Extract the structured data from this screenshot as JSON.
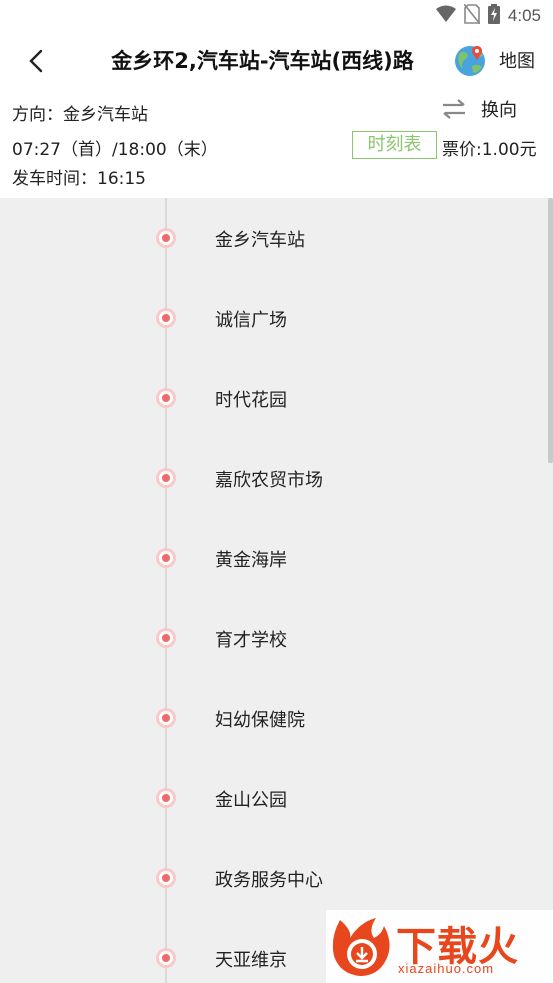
{
  "status_bar": {
    "time": "4:05",
    "icons": [
      "wifi-icon",
      "no-sim-icon",
      "battery-charging-icon"
    ]
  },
  "header": {
    "title": "金乡环2,汽车站-汽车站(西线)路",
    "map_label": "地图"
  },
  "route_info": {
    "direction": "方向：金乡汽车站",
    "swap_label": "换向",
    "hours": "07:27（首）/18:00（末）",
    "timetable_label": "时刻表",
    "fare": "票价:1.00元",
    "departure": "发车时间：16:15"
  },
  "stops": [
    {
      "name": "金乡汽车站"
    },
    {
      "name": "诚信广场"
    },
    {
      "name": "时代花园"
    },
    {
      "name": "嘉欣农贸市场"
    },
    {
      "name": "黄金海岸"
    },
    {
      "name": "育才学校"
    },
    {
      "name": "妇幼保健院"
    },
    {
      "name": "金山公园"
    },
    {
      "name": "政务服务中心"
    },
    {
      "name": "天亚维京"
    }
  ],
  "watermark": {
    "text": "下载火",
    "sub": "xiazaihuo.com"
  },
  "colors": {
    "accent_green": "#8cc66f",
    "stop_dot": "#ef6a6a",
    "list_background": "#efefef",
    "watermark": "#e8461c"
  }
}
